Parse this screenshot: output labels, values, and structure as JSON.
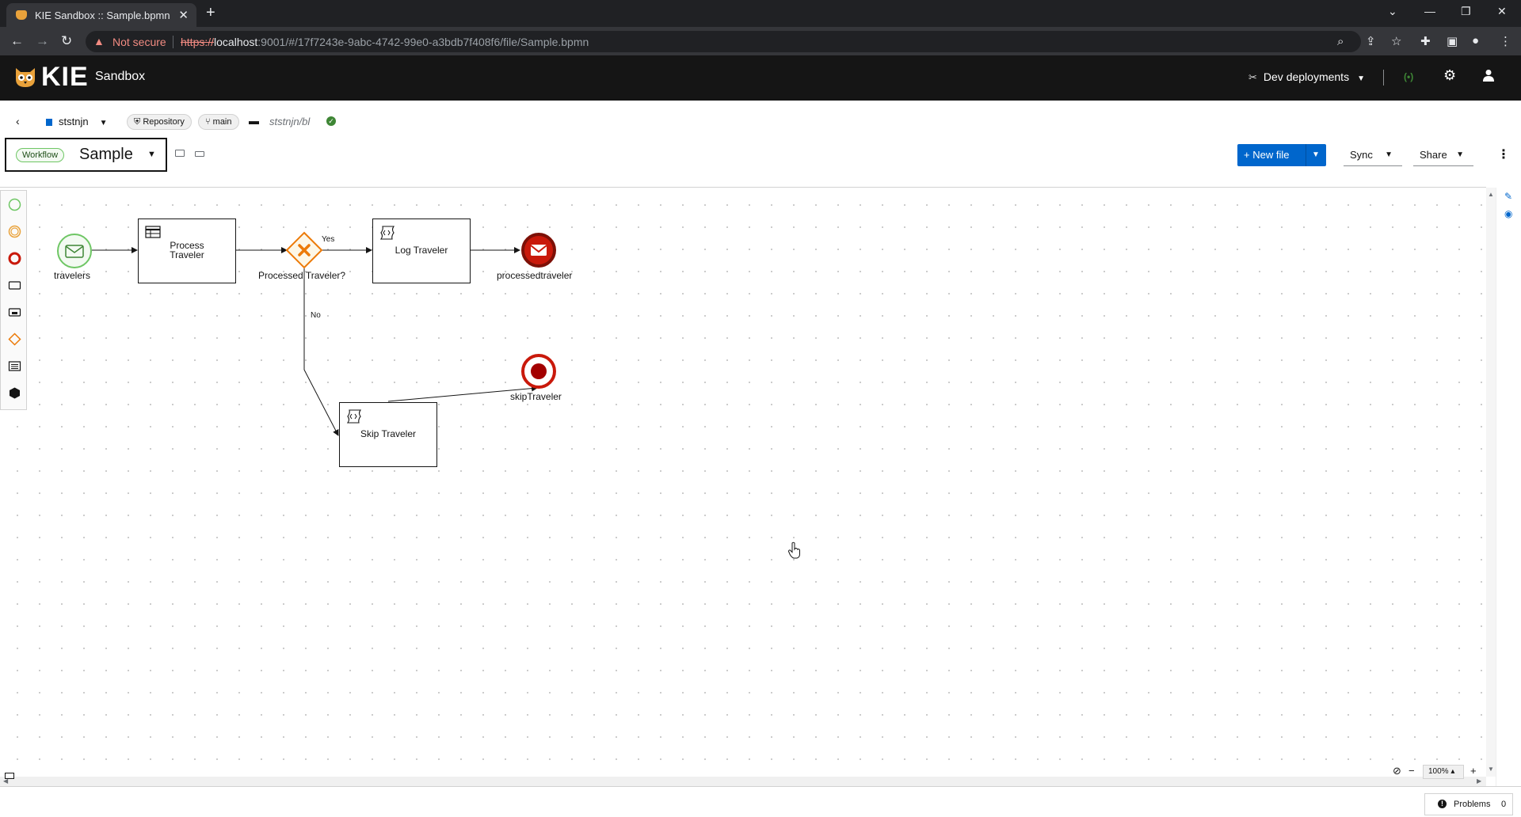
{
  "browser": {
    "tab_title": "KIE Sandbox :: Sample.bpmn",
    "security_label": "Not secure",
    "url_scheme": "https://",
    "url_host": "localhost",
    "url_rest": ":9001/#/17f7243e-9abc-4742-99e0-a3bdb7f408f6/file/Sample.bpmn"
  },
  "header": {
    "brand": "KIE",
    "product": "Sandbox",
    "deployments_label": "Dev deployments",
    "connection_indicator": "(•)"
  },
  "breadcrumb": {
    "workspace": "ststnjn",
    "repository_chip": "Repository",
    "branch_chip": "main",
    "path": "ststnjn/bl"
  },
  "file": {
    "type_label": "Workflow",
    "name": "Sample"
  },
  "toolbar": {
    "new_file_label": "New file",
    "sync_label": "Sync",
    "share_label": "Share"
  },
  "diagram": {
    "start_event_label": "travelers",
    "task_process_label_line1": "Process",
    "task_process_label_line2": "Traveler",
    "gateway_label": "Processed Traveler?",
    "yes_label": "Yes",
    "no_label": "No",
    "task_log_label": "Log Traveler",
    "end_message_label": "processedtraveler",
    "end_terminate_label": "skipTraveler",
    "task_skip_label": "Skip Traveler"
  },
  "zoom": {
    "value": "100%"
  },
  "status": {
    "problems_label": "Problems",
    "problems_count": "0"
  },
  "colors": {
    "accent": "#0066cc",
    "start_event": "#6ec664",
    "end_event": "#a30000",
    "gateway": "#ec7a08"
  }
}
